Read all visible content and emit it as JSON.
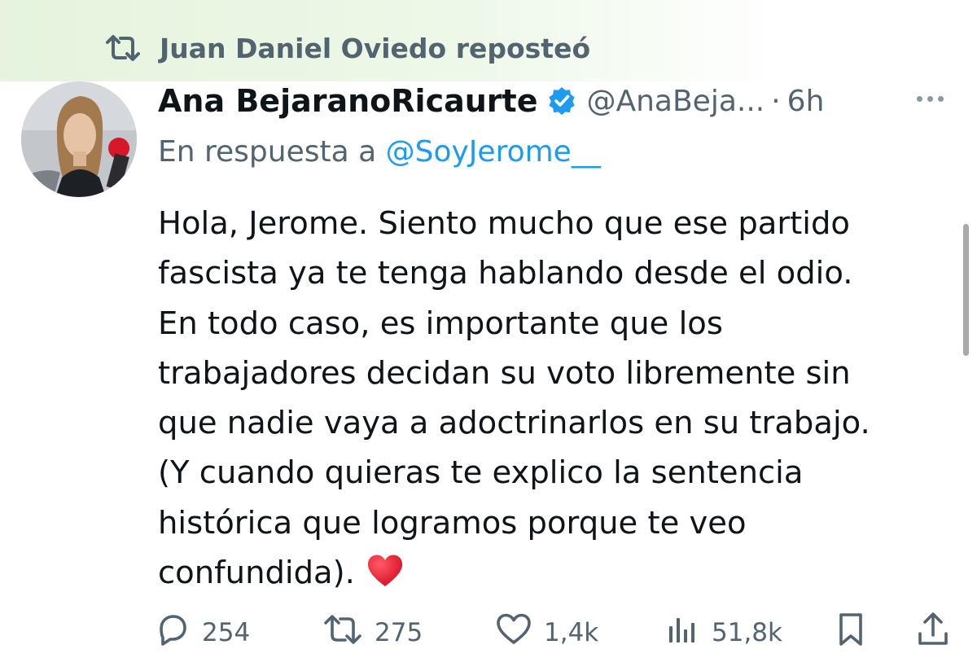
{
  "repost": {
    "text": "Juan Daniel Oviedo reposteó",
    "icon": "repost-icon"
  },
  "author": {
    "name": "Ana BejaranoRicaurte",
    "verified_icon": "verified-badge-icon",
    "handle": "@AnaBeja...",
    "separator": "·",
    "time": "6h"
  },
  "reply": {
    "prefix": "En respuesta a",
    "mention": "@SoyJerome__"
  },
  "tweet": {
    "lines": [
      "Hola, Jerome. Siento mucho que ese partido",
      "fascista ya te tenga hablando desde el odio.",
      "En todo caso, es importante que los",
      "trabajadores decidan su voto libremente sin",
      "que nadie vaya a adoctrinarlos en su trabajo.",
      "(Y cuando quieras te explico la sentencia",
      "histórica que logramos porque te veo",
      "confundida)."
    ],
    "trailing_emoji": "red-heart-emoji"
  },
  "actions": {
    "replies": "254",
    "reposts": "275",
    "likes": "1,4k",
    "views": "51,8k"
  },
  "colors": {
    "text_primary": "#0f1419",
    "text_secondary": "#536471",
    "link": "#1d9bf0",
    "verified": "#1d9bf0",
    "heart": "#e0162b",
    "repost_highlight": "#e2f2da"
  }
}
